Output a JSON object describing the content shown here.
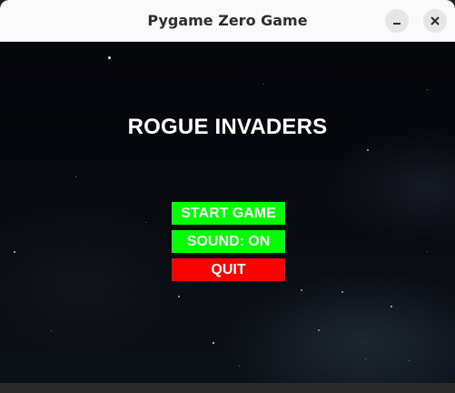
{
  "window": {
    "title": "Pygame Zero Game",
    "minimize_icon": "minimize-icon",
    "close_icon": "close-icon"
  },
  "game": {
    "title": "ROGUE INVADERS",
    "menu": {
      "start": {
        "label": "START GAME",
        "color": "#00ff00"
      },
      "sound": {
        "label": "SOUND: ON",
        "color": "#00ff00"
      },
      "quit": {
        "label": "QUIT",
        "color": "#ff0000"
      }
    }
  }
}
